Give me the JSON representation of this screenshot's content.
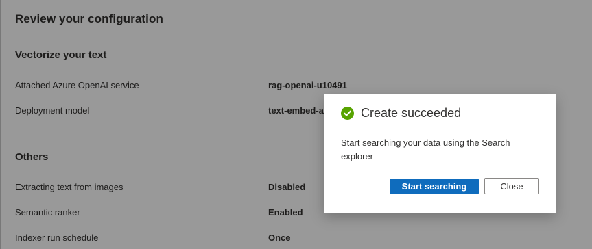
{
  "page": {
    "title": "Review your configuration"
  },
  "vectorize": {
    "section_title": "Vectorize your text",
    "rows": [
      {
        "label": "Attached Azure OpenAI service",
        "value": "rag-openai-u10491"
      },
      {
        "label": "Deployment model",
        "value": "text-embed-a"
      }
    ]
  },
  "others": {
    "section_title": "Others",
    "rows": [
      {
        "label": "Extracting text from images",
        "value": "Disabled"
      },
      {
        "label": "Semantic ranker",
        "value": "Enabled"
      },
      {
        "label": "Indexer run schedule",
        "value": "Once"
      }
    ]
  },
  "dialog": {
    "icon": "check-circle-icon",
    "title": "Create succeeded",
    "message": "Start searching your data using the Search explorer",
    "primary_button": "Start searching",
    "secondary_button": "Close"
  },
  "colors": {
    "success": "#57a300",
    "primary": "#0f6cbd",
    "overlay": "rgba(0,0,0,0.4)"
  }
}
